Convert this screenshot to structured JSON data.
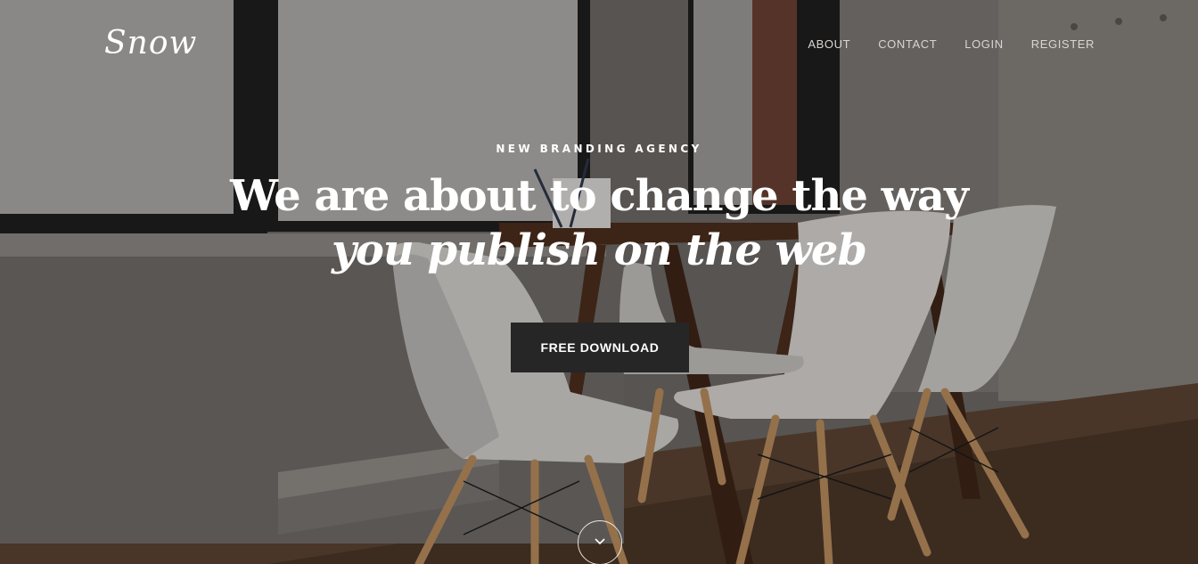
{
  "brand": {
    "logo_text": "Snow"
  },
  "nav": {
    "items": [
      {
        "label": "ABOUT"
      },
      {
        "label": "CONTACT"
      },
      {
        "label": "LOGIN"
      },
      {
        "label": "REGISTER"
      }
    ]
  },
  "hero": {
    "eyebrow": "NEW BRANDING AGENCY",
    "headline_line1": "We are about to change the way",
    "headline_line2": "you publish on the web",
    "cta_label": "FREE DOWNLOAD",
    "scroll_icon": "chevron-down-icon"
  },
  "colors": {
    "button_bg": "#262626",
    "text": "#ffffff",
    "nav_text": "#d9d6d2"
  }
}
